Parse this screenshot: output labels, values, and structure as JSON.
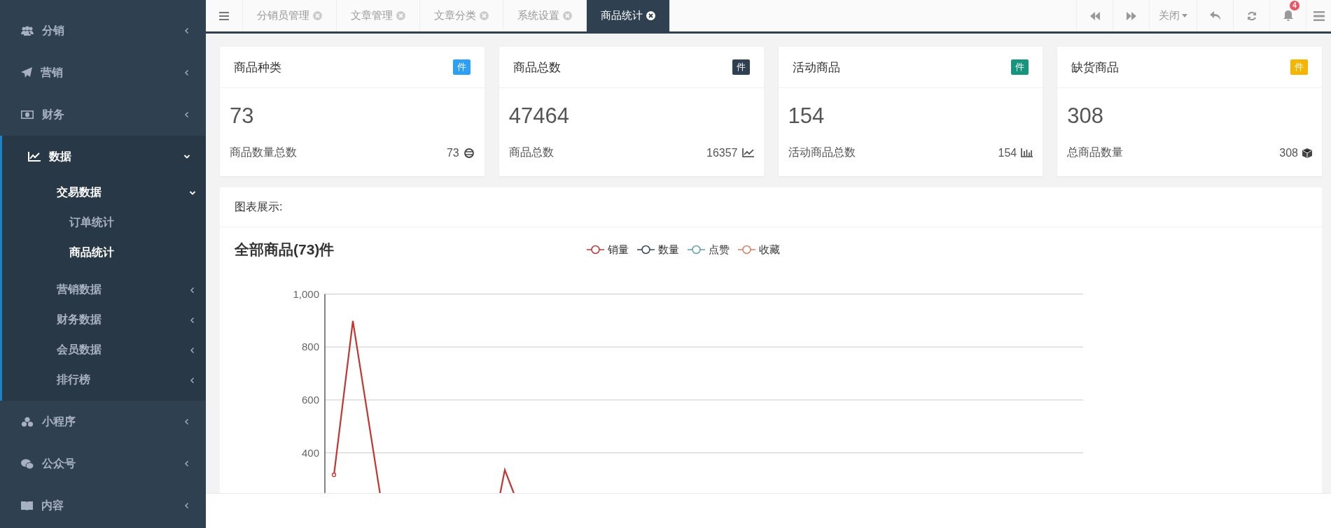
{
  "sidebar": {
    "items": [
      {
        "label": "分销",
        "expanded": false
      },
      {
        "label": "营销",
        "expanded": false
      },
      {
        "label": "财务",
        "expanded": false
      },
      {
        "label": "数据",
        "expanded": true,
        "children": [
          {
            "label": "交易数据",
            "expanded": true,
            "children": [
              {
                "label": "订单统计",
                "selected": false
              },
              {
                "label": "商品统计",
                "selected": true
              }
            ]
          },
          {
            "label": "营销数据",
            "expanded": false
          },
          {
            "label": "财务数据",
            "expanded": false
          },
          {
            "label": "会员数据",
            "expanded": false
          },
          {
            "label": "排行榜",
            "expanded": false
          }
        ]
      },
      {
        "label": "小程序",
        "expanded": false
      },
      {
        "label": "公众号",
        "expanded": false
      },
      {
        "label": "内容",
        "expanded": false
      }
    ]
  },
  "tabs": [
    {
      "label": "分销员管理",
      "selected": false
    },
    {
      "label": "文章管理",
      "selected": false
    },
    {
      "label": "文章分类",
      "selected": false
    },
    {
      "label": "系统设置",
      "selected": false
    },
    {
      "label": "商品统计",
      "selected": true
    }
  ],
  "toolbar": {
    "close_menu": "关闭",
    "notification_count": "4"
  },
  "stat_cards": [
    {
      "title": "商品种类",
      "badge": "件",
      "color": "#2d9ff5",
      "value": "73",
      "caption": "商品数量总数",
      "total": "73"
    },
    {
      "title": "商品总数",
      "badge": "件",
      "color": "#2f4050",
      "value": "47464",
      "caption": "商品总数",
      "total": "16357"
    },
    {
      "title": "活动商品",
      "badge": "件",
      "color": "#17957c",
      "value": "154",
      "caption": "活动商品总数",
      "total": "154"
    },
    {
      "title": "缺货商品",
      "badge": "件",
      "color": "#f6b500",
      "value": "308",
      "caption": "总商品数量",
      "total": "308"
    }
  ],
  "chart_panel": {
    "heading": "图表展示:",
    "chart_title": "全部商品(73)件",
    "legend": [
      {
        "name": "销量",
        "color": "#c23531"
      },
      {
        "name": "数量",
        "color": "#2f4554"
      },
      {
        "name": "点赞",
        "color": "#61a0a8"
      },
      {
        "name": "收藏",
        "color": "#d48265"
      }
    ],
    "y_axis_labels": [
      "1,000",
      "800",
      "600",
      "400"
    ]
  }
}
